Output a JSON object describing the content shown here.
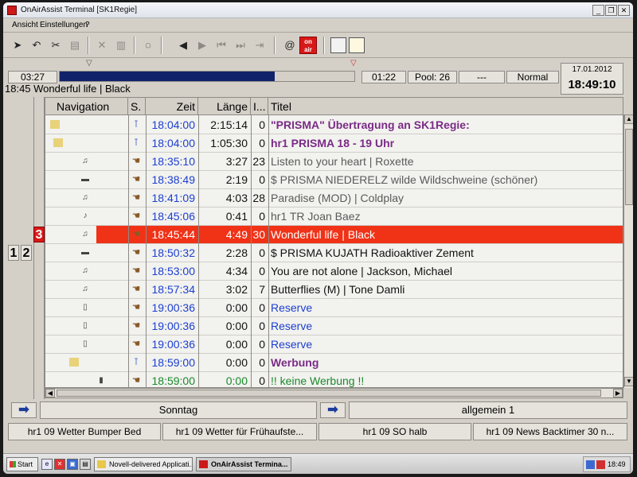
{
  "window": {
    "title": "OnAirAssist Terminal [SK1Regie]",
    "buttons": [
      "_",
      "❐",
      "✕"
    ]
  },
  "menu": {
    "items": [
      "Ansicht",
      "Einstellungen",
      "?"
    ]
  },
  "toolbar": {
    "onair_label": "on air"
  },
  "timeline": {
    "elapsed": "03:27",
    "remaining": "01:22",
    "pool": "Pool: 26",
    "dash": "---",
    "mode": "Normal",
    "date": "17.01.2012",
    "clock": "18:49:10",
    "progress": 0.73,
    "now_playing": "18:45  Wonderful life | Black"
  },
  "layers": [
    "1",
    "2",
    "3"
  ],
  "columns": {
    "navigation": "Navigation",
    "s": "S.",
    "zeit": "Zeit",
    "laenge": "Länge",
    "i": "I...",
    "titel": "Titel"
  },
  "rows": [
    {
      "zeit": "18:04:00",
      "laenge": "2:15:14",
      "i": "0",
      "titel": "\"PRISMA\" Übertragung an SK1Regie:",
      "style": "group",
      "nav": "folder",
      "status": "pin"
    },
    {
      "zeit": "18:04:00",
      "laenge": "1:05:30",
      "i": "0",
      "titel": "hr1 PRISMA 18 - 19 Uhr",
      "style": "group",
      "nav": "folder-open",
      "status": "pin"
    },
    {
      "zeit": "18:35:10",
      "laenge": "3:27",
      "i": "23",
      "titel": "Listen to your heart | Roxette",
      "style": "played",
      "nav": "music",
      "status": "hand"
    },
    {
      "zeit": "18:38:49",
      "laenge": "2:19",
      "i": "0",
      "titel": "$ PRISMA NIEDERELZ wilde Wildschweine (schöner)",
      "style": "played",
      "nav": "media",
      "status": "hand"
    },
    {
      "zeit": "18:41:09",
      "laenge": "4:03",
      "i": "28",
      "titel": "Paradise (MOD) | Coldplay",
      "style": "played",
      "nav": "music",
      "status": "hand"
    },
    {
      "zeit": "18:45:06",
      "laenge": "0:41",
      "i": "0",
      "titel": "hr1 TR Joan Baez",
      "style": "played",
      "nav": "jingle",
      "status": "hand"
    },
    {
      "zeit": "18:45:44",
      "laenge": "4:49",
      "i": "30",
      "titel": "Wonderful life | Black",
      "style": "current",
      "nav": "music",
      "status": "hand"
    },
    {
      "zeit": "18:50:32",
      "laenge": "2:28",
      "i": "0",
      "titel": "$ PRISMA KUJATH Radioaktiver Zement",
      "style": "normal",
      "nav": "media",
      "status": "hand"
    },
    {
      "zeit": "18:53:00",
      "laenge": "4:34",
      "i": "0",
      "titel": "You are not alone | Jackson, Michael",
      "style": "normal",
      "nav": "music",
      "status": "hand"
    },
    {
      "zeit": "18:57:34",
      "laenge": "3:02",
      "i": "7",
      "titel": "Butterflies (M) | Tone Damli",
      "style": "normal",
      "nav": "music",
      "status": "hand"
    },
    {
      "zeit": "19:00:36",
      "laenge": "0:00",
      "i": "0",
      "titel": "Reserve",
      "style": "reserve",
      "nav": "doc",
      "status": "hand"
    },
    {
      "zeit": "19:00:36",
      "laenge": "0:00",
      "i": "0",
      "titel": "Reserve",
      "style": "reserve",
      "nav": "doc",
      "status": "hand"
    },
    {
      "zeit": "19:00:36",
      "laenge": "0:00",
      "i": "0",
      "titel": "Reserve",
      "style": "reserve",
      "nav": "doc",
      "status": "hand"
    },
    {
      "zeit": "18:59:00",
      "laenge": "0:00",
      "i": "0",
      "titel": "Werbung",
      "style": "ad-group",
      "nav": "folder-open",
      "status": "pin"
    },
    {
      "zeit": "18:59:00",
      "laenge": "0:00",
      "i": "0",
      "titel": "!!  keine  Werbung  !!",
      "style": "ad",
      "nav": "phone",
      "status": "hand"
    }
  ],
  "bottom": {
    "day": "Sonntag",
    "category": "allgemein  1"
  },
  "carts": [
    "hr1 09 Wetter Bumper Bed",
    "hr1 09 Wetter für Frühaufste...",
    "hr1 09 SO halb",
    "hr1 09 News Backtimer 30  n..."
  ],
  "taskbar": {
    "start": "Start",
    "tasks": [
      "Novell-delivered Applicati...",
      "OnAirAssist Termina..."
    ],
    "clock": "18:49"
  },
  "colors": {
    "current": "#f03217",
    "group": "#7a2b86",
    "reserve": "#1c3fd0",
    "ad": "#198a2a",
    "progress": "#10226a"
  }
}
